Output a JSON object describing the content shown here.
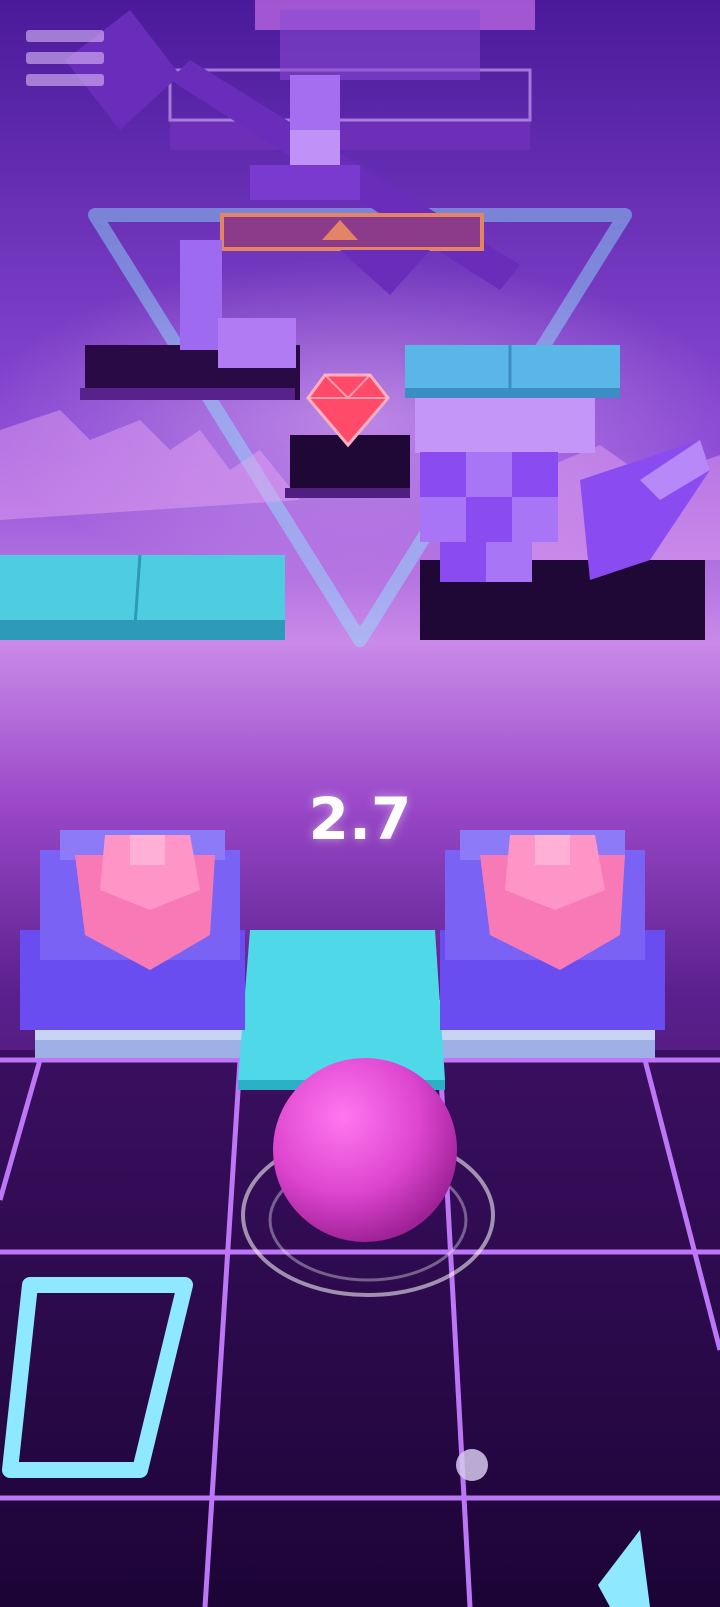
{
  "hud": {
    "score": "2.7"
  },
  "icons": {
    "menu": "hamburger-menu-icon",
    "gem": "gem-icon"
  },
  "colors": {
    "ball": "#e04bd0",
    "tile_cyan": "#4fd8e8",
    "tile_dark": "#2a0a45",
    "grid_line": "#c47cff",
    "block_purple": "#8a4cf0",
    "flower_pink": "#f77ab6",
    "gem_red": "#ff4a6a"
  }
}
